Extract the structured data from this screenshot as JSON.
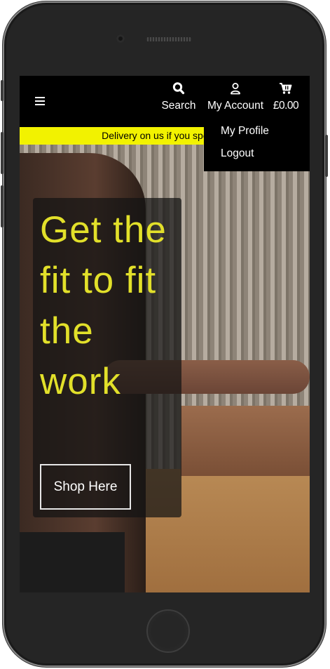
{
  "navbar": {
    "menu_icon": "hamburger-icon",
    "search_label": "Search",
    "search_icon": "search-icon",
    "account_label": "My Account",
    "account_icon": "user-icon",
    "cart_label": "£0.00",
    "cart_icon": "cart-icon"
  },
  "promo_banner": {
    "text": "Delivery on us if you spend o"
  },
  "account_dropdown": {
    "items": [
      {
        "label": "My Profile"
      },
      {
        "label": "Logout"
      }
    ]
  },
  "hero": {
    "heading": "Get the fit to fit the work",
    "cta_label": "Shop Here"
  },
  "colors": {
    "accent_yellow": "#f2f200",
    "hero_text": "#e2e02a",
    "navbar_bg": "#000000"
  }
}
